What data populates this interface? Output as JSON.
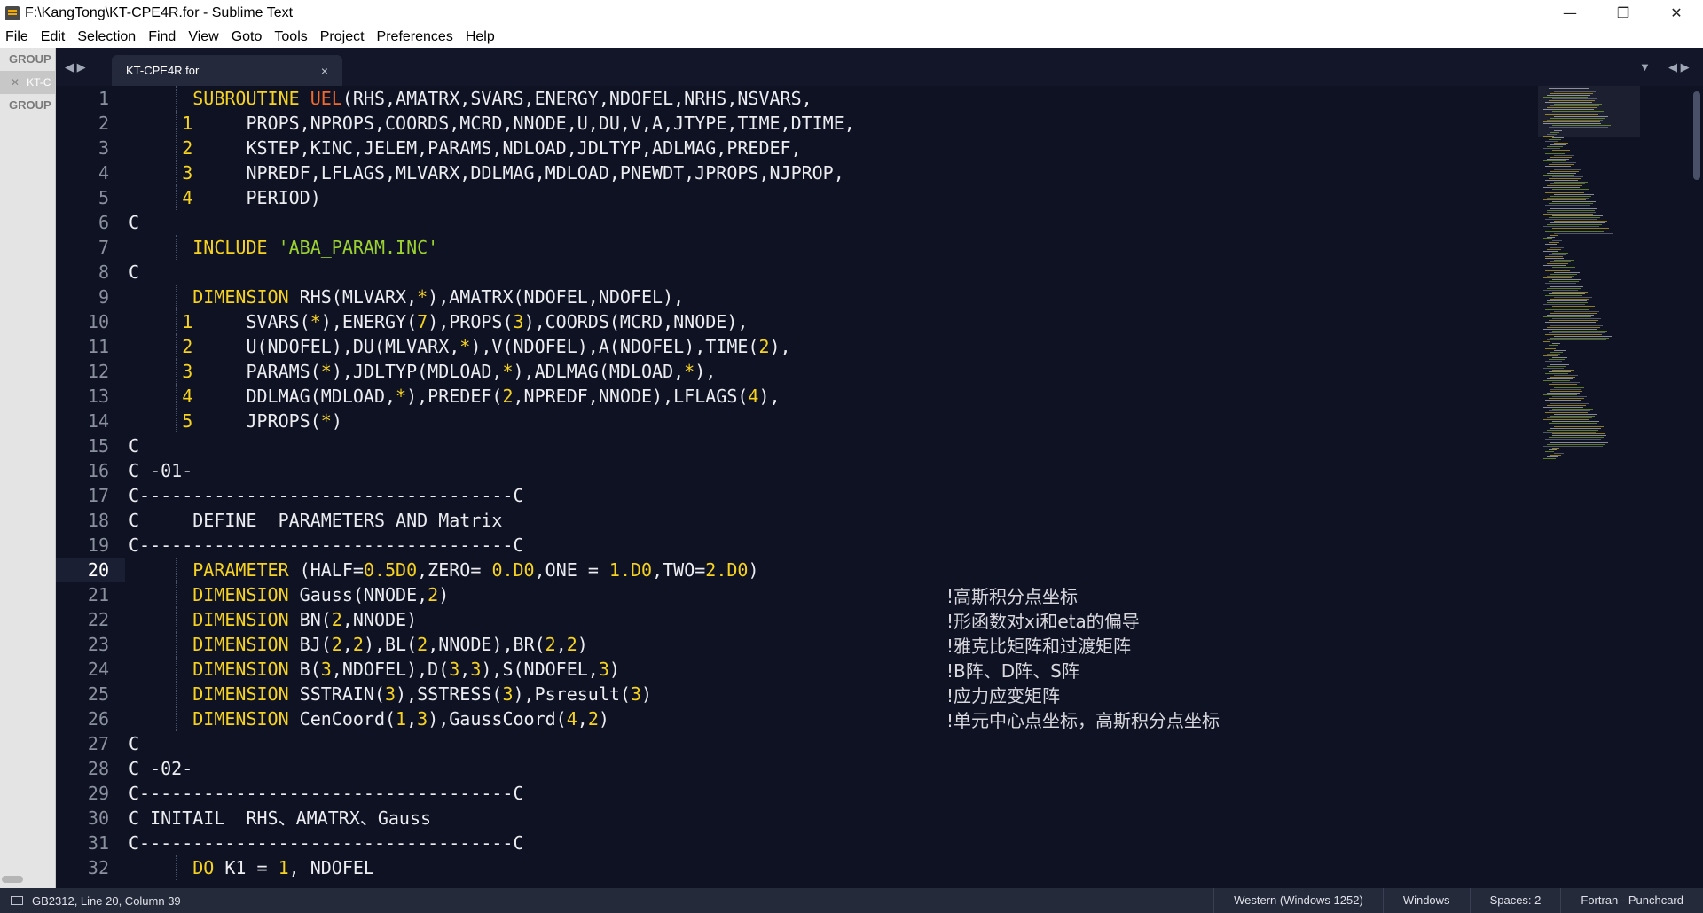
{
  "window": {
    "title": "F:\\KangTong\\KT-CPE4R.for - Sublime Text",
    "minimize_glyph": "—",
    "maximize_glyph": "❐",
    "close_glyph": "✕"
  },
  "menu": {
    "items": [
      {
        "label": "File"
      },
      {
        "label": "Edit"
      },
      {
        "label": "Selection"
      },
      {
        "label": "Find"
      },
      {
        "label": "View"
      },
      {
        "label": "Goto"
      },
      {
        "label": "Tools"
      },
      {
        "label": "Project"
      },
      {
        "label": "Preferences"
      },
      {
        "label": "Help"
      }
    ]
  },
  "sidebar": {
    "group1": "GROUP",
    "file_close": "✕",
    "file": "KT-C",
    "group2": "GROUP"
  },
  "tabs": {
    "nav_left": "◀ ▶",
    "nav_right": "▼",
    "nav_right2": "◀ ▶",
    "active": {
      "label": "KT-CPE4R.for",
      "close": "×"
    }
  },
  "editor": {
    "current_line": 20,
    "line_numbers": [
      "1",
      "2",
      "3",
      "4",
      "5",
      "6",
      "7",
      "8",
      "9",
      "10",
      "11",
      "12",
      "13",
      "14",
      "15",
      "16",
      "17",
      "18",
      "19",
      "20",
      "21",
      "22",
      "23",
      "24",
      "25",
      "26",
      "27",
      "28",
      "29",
      "30",
      "31",
      "32"
    ]
  },
  "status": {
    "position": "GB2312, Line 20, Column 39",
    "encoding": "Western (Windows 1252)",
    "line_endings": "Windows",
    "indentation": "Spaces: 2",
    "syntax": "Fortran - Punchcard"
  },
  "colors": {
    "editor_bg": "#0e1223",
    "keyword": "#f7d320",
    "function": "#f26a2b",
    "string": "#9cd230",
    "text": "#ecedf1",
    "status_bg": "#252a3a"
  }
}
